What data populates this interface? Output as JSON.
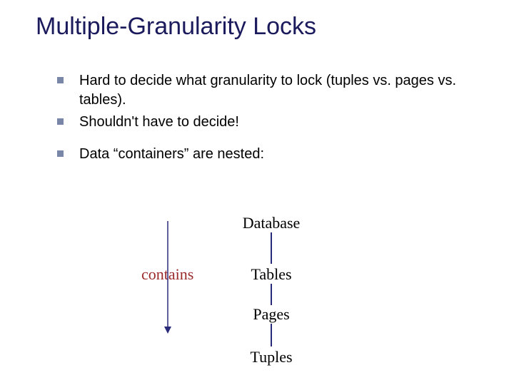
{
  "title": "Multiple-Granularity Locks",
  "bullets": {
    "b1": "Hard to decide what granularity to lock (tuples vs. pages vs. tables).",
    "b2": "Shouldn't have to decide!",
    "b3": "Data “containers” are nested:"
  },
  "diagram": {
    "contains": "contains",
    "levels": {
      "database": "Database",
      "tables": "Tables",
      "pages": "Pages",
      "tuples": "Tuples"
    }
  }
}
